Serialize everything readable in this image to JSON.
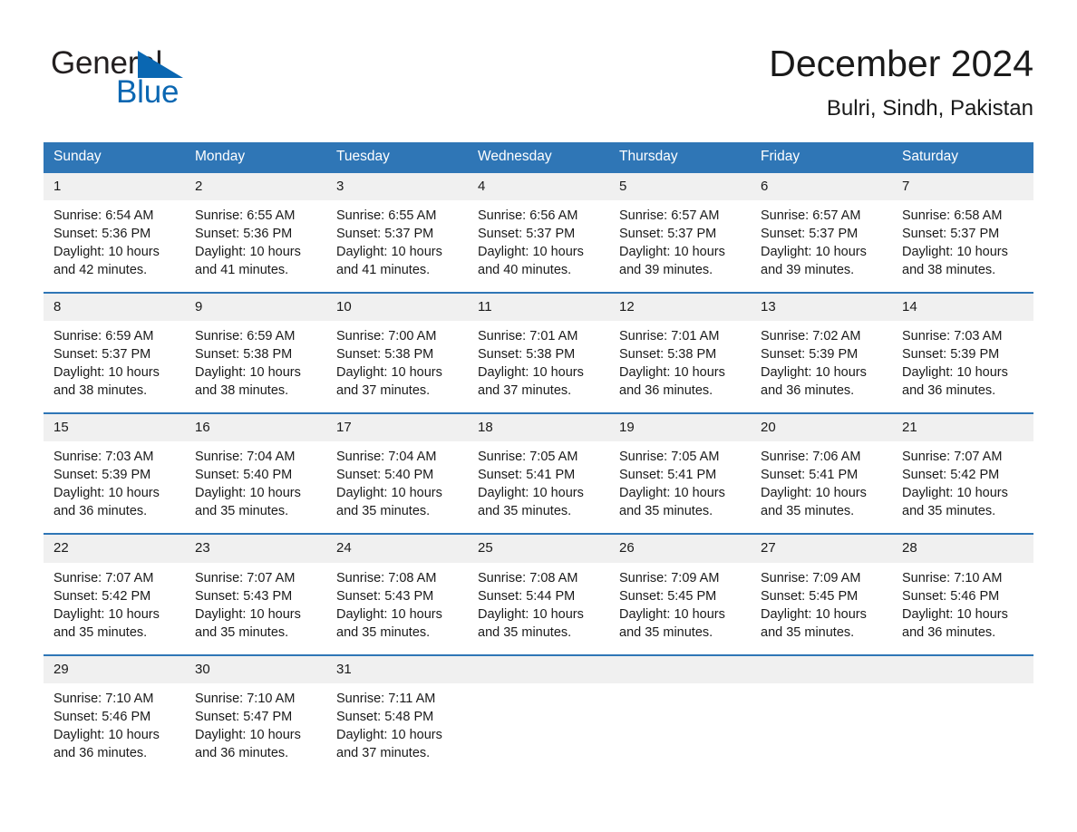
{
  "brand": {
    "name_top": "General",
    "name_bottom": "Blue",
    "flag_icon": "triangle-flag-icon",
    "color_black": "#231f20",
    "color_blue": "#0a67b2"
  },
  "header": {
    "title": "December 2024",
    "location": "Bulri, Sindh, Pakistan"
  },
  "theme": {
    "header_blue": "#2f76b6",
    "daynum_band": "#f0f0f0",
    "text": "#1a1a1a"
  },
  "calendar": {
    "weekdays": [
      "Sunday",
      "Monday",
      "Tuesday",
      "Wednesday",
      "Thursday",
      "Friday",
      "Saturday"
    ],
    "weeks": [
      [
        {
          "day": "1",
          "sunrise": "Sunrise: 6:54 AM",
          "sunset": "Sunset: 5:36 PM",
          "daylight": "Daylight: 10 hours and 42 minutes."
        },
        {
          "day": "2",
          "sunrise": "Sunrise: 6:55 AM",
          "sunset": "Sunset: 5:36 PM",
          "daylight": "Daylight: 10 hours and 41 minutes."
        },
        {
          "day": "3",
          "sunrise": "Sunrise: 6:55 AM",
          "sunset": "Sunset: 5:37 PM",
          "daylight": "Daylight: 10 hours and 41 minutes."
        },
        {
          "day": "4",
          "sunrise": "Sunrise: 6:56 AM",
          "sunset": "Sunset: 5:37 PM",
          "daylight": "Daylight: 10 hours and 40 minutes."
        },
        {
          "day": "5",
          "sunrise": "Sunrise: 6:57 AM",
          "sunset": "Sunset: 5:37 PM",
          "daylight": "Daylight: 10 hours and 39 minutes."
        },
        {
          "day": "6",
          "sunrise": "Sunrise: 6:57 AM",
          "sunset": "Sunset: 5:37 PM",
          "daylight": "Daylight: 10 hours and 39 minutes."
        },
        {
          "day": "7",
          "sunrise": "Sunrise: 6:58 AM",
          "sunset": "Sunset: 5:37 PM",
          "daylight": "Daylight: 10 hours and 38 minutes."
        }
      ],
      [
        {
          "day": "8",
          "sunrise": "Sunrise: 6:59 AM",
          "sunset": "Sunset: 5:37 PM",
          "daylight": "Daylight: 10 hours and 38 minutes."
        },
        {
          "day": "9",
          "sunrise": "Sunrise: 6:59 AM",
          "sunset": "Sunset: 5:38 PM",
          "daylight": "Daylight: 10 hours and 38 minutes."
        },
        {
          "day": "10",
          "sunrise": "Sunrise: 7:00 AM",
          "sunset": "Sunset: 5:38 PM",
          "daylight": "Daylight: 10 hours and 37 minutes."
        },
        {
          "day": "11",
          "sunrise": "Sunrise: 7:01 AM",
          "sunset": "Sunset: 5:38 PM",
          "daylight": "Daylight: 10 hours and 37 minutes."
        },
        {
          "day": "12",
          "sunrise": "Sunrise: 7:01 AM",
          "sunset": "Sunset: 5:38 PM",
          "daylight": "Daylight: 10 hours and 36 minutes."
        },
        {
          "day": "13",
          "sunrise": "Sunrise: 7:02 AM",
          "sunset": "Sunset: 5:39 PM",
          "daylight": "Daylight: 10 hours and 36 minutes."
        },
        {
          "day": "14",
          "sunrise": "Sunrise: 7:03 AM",
          "sunset": "Sunset: 5:39 PM",
          "daylight": "Daylight: 10 hours and 36 minutes."
        }
      ],
      [
        {
          "day": "15",
          "sunrise": "Sunrise: 7:03 AM",
          "sunset": "Sunset: 5:39 PM",
          "daylight": "Daylight: 10 hours and 36 minutes."
        },
        {
          "day": "16",
          "sunrise": "Sunrise: 7:04 AM",
          "sunset": "Sunset: 5:40 PM",
          "daylight": "Daylight: 10 hours and 35 minutes."
        },
        {
          "day": "17",
          "sunrise": "Sunrise: 7:04 AM",
          "sunset": "Sunset: 5:40 PM",
          "daylight": "Daylight: 10 hours and 35 minutes."
        },
        {
          "day": "18",
          "sunrise": "Sunrise: 7:05 AM",
          "sunset": "Sunset: 5:41 PM",
          "daylight": "Daylight: 10 hours and 35 minutes."
        },
        {
          "day": "19",
          "sunrise": "Sunrise: 7:05 AM",
          "sunset": "Sunset: 5:41 PM",
          "daylight": "Daylight: 10 hours and 35 minutes."
        },
        {
          "day": "20",
          "sunrise": "Sunrise: 7:06 AM",
          "sunset": "Sunset: 5:41 PM",
          "daylight": "Daylight: 10 hours and 35 minutes."
        },
        {
          "day": "21",
          "sunrise": "Sunrise: 7:07 AM",
          "sunset": "Sunset: 5:42 PM",
          "daylight": "Daylight: 10 hours and 35 minutes."
        }
      ],
      [
        {
          "day": "22",
          "sunrise": "Sunrise: 7:07 AM",
          "sunset": "Sunset: 5:42 PM",
          "daylight": "Daylight: 10 hours and 35 minutes."
        },
        {
          "day": "23",
          "sunrise": "Sunrise: 7:07 AM",
          "sunset": "Sunset: 5:43 PM",
          "daylight": "Daylight: 10 hours and 35 minutes."
        },
        {
          "day": "24",
          "sunrise": "Sunrise: 7:08 AM",
          "sunset": "Sunset: 5:43 PM",
          "daylight": "Daylight: 10 hours and 35 minutes."
        },
        {
          "day": "25",
          "sunrise": "Sunrise: 7:08 AM",
          "sunset": "Sunset: 5:44 PM",
          "daylight": "Daylight: 10 hours and 35 minutes."
        },
        {
          "day": "26",
          "sunrise": "Sunrise: 7:09 AM",
          "sunset": "Sunset: 5:45 PM",
          "daylight": "Daylight: 10 hours and 35 minutes."
        },
        {
          "day": "27",
          "sunrise": "Sunrise: 7:09 AM",
          "sunset": "Sunset: 5:45 PM",
          "daylight": "Daylight: 10 hours and 35 minutes."
        },
        {
          "day": "28",
          "sunrise": "Sunrise: 7:10 AM",
          "sunset": "Sunset: 5:46 PM",
          "daylight": "Daylight: 10 hours and 36 minutes."
        }
      ],
      [
        {
          "day": "29",
          "sunrise": "Sunrise: 7:10 AM",
          "sunset": "Sunset: 5:46 PM",
          "daylight": "Daylight: 10 hours and 36 minutes."
        },
        {
          "day": "30",
          "sunrise": "Sunrise: 7:10 AM",
          "sunset": "Sunset: 5:47 PM",
          "daylight": "Daylight: 10 hours and 36 minutes."
        },
        {
          "day": "31",
          "sunrise": "Sunrise: 7:11 AM",
          "sunset": "Sunset: 5:48 PM",
          "daylight": "Daylight: 10 hours and 37 minutes."
        },
        {
          "day": "",
          "sunrise": "",
          "sunset": "",
          "daylight": ""
        },
        {
          "day": "",
          "sunrise": "",
          "sunset": "",
          "daylight": ""
        },
        {
          "day": "",
          "sunrise": "",
          "sunset": "",
          "daylight": ""
        },
        {
          "day": "",
          "sunrise": "",
          "sunset": "",
          "daylight": ""
        }
      ]
    ]
  }
}
